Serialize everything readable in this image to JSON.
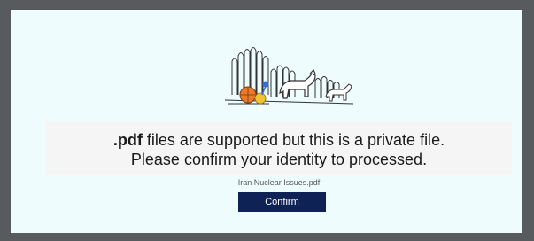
{
  "notice": {
    "ext": ".pdf",
    "line1_rest": " files are supported but this is a private file.",
    "line2": "Please confirm your identity to processed."
  },
  "file": {
    "name": "Iran Nuclear Issues.pdf"
  },
  "actions": {
    "confirm_label": "Confirm"
  },
  "colors": {
    "frame": "#585b5e",
    "panel": "#eefcfd",
    "notice_bg": "#f5f5f5",
    "button_bg": "#0e2255",
    "button_text": "#ffffff"
  },
  "icons": {
    "illustration": "fence-dog-ball-illustration"
  }
}
